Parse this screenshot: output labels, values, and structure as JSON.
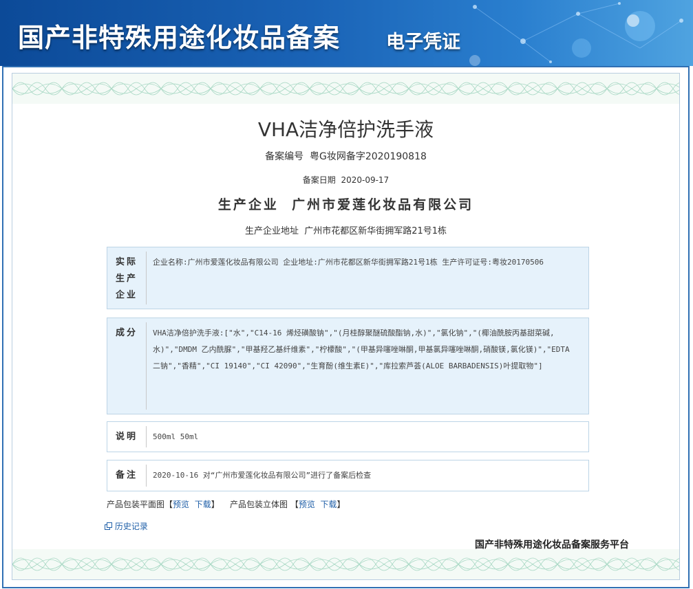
{
  "header": {
    "title": "国产非特殊用途化妆品备案",
    "subtitle": "电子凭证"
  },
  "product": {
    "name": "VHA洁净倍护洗手液",
    "reg_number_label": "备案编号",
    "reg_number": "粤G妆网备字2020190818",
    "reg_date_label": "备案日期",
    "reg_date": "2020-09-17",
    "manufacturer_label": "生产企业",
    "manufacturer": "广州市爱莲化妆品有限公司",
    "manufacturer_address_label": "生产企业地址",
    "manufacturer_address": "广州市花都区新华街拥军路21号1栋"
  },
  "details": {
    "actual_producer": {
      "label_lines": [
        "实际",
        "生产",
        "企业"
      ],
      "value": "企业名称:广州市爱莲化妆品有限公司 企业地址:广州市花都区新华街拥军路21号1栋 生产许可证号:粤妆20170506"
    },
    "ingredients": {
      "label": "成分",
      "value": "VHA洁净倍护洗手液:[\"水\",\"C14-16 烯烃磺酸钠\",\"(月桂醇聚醚硫酸酯钠,水)\",\"氯化钠\",\"(椰油酰胺丙基甜菜碱,水)\",\"DMDM 乙内酰脲\",\"甲基羟乙基纤维素\",\"柠檬酸\",\"(甲基异噻唑啉酮,甲基氯异噻唑啉酮,硝酸镁,氯化镁)\",\"EDTA 二钠\",\"香精\",\"CI 19140\",\"CI 42090\",\"生育酚(维生素E)\",\"库拉索芦荟(ALOE BARBADENSIS)叶提取物\"]"
    },
    "description": {
      "label": "说明",
      "value": "500ml 50ml"
    },
    "remarks": {
      "label": "备注",
      "value": "2020-10-16 对“广州市爱莲化妆品有限公司”进行了备案后检查"
    }
  },
  "downloads": {
    "flat_label": "产品包装平面图",
    "solid_label": "产品包装立体图",
    "bracket_open": "【",
    "bracket_close": "】",
    "preview": "预览",
    "download": "下载"
  },
  "history_link": "历史记录",
  "history_icon": "history-icon",
  "platform": "国产非特殊用途化妆品备案服务平台",
  "colors": {
    "banner": "#1a63b6",
    "row_blue": "#e6f2fb",
    "link": "#1f5fa8",
    "frame": "#2f6fb3"
  }
}
